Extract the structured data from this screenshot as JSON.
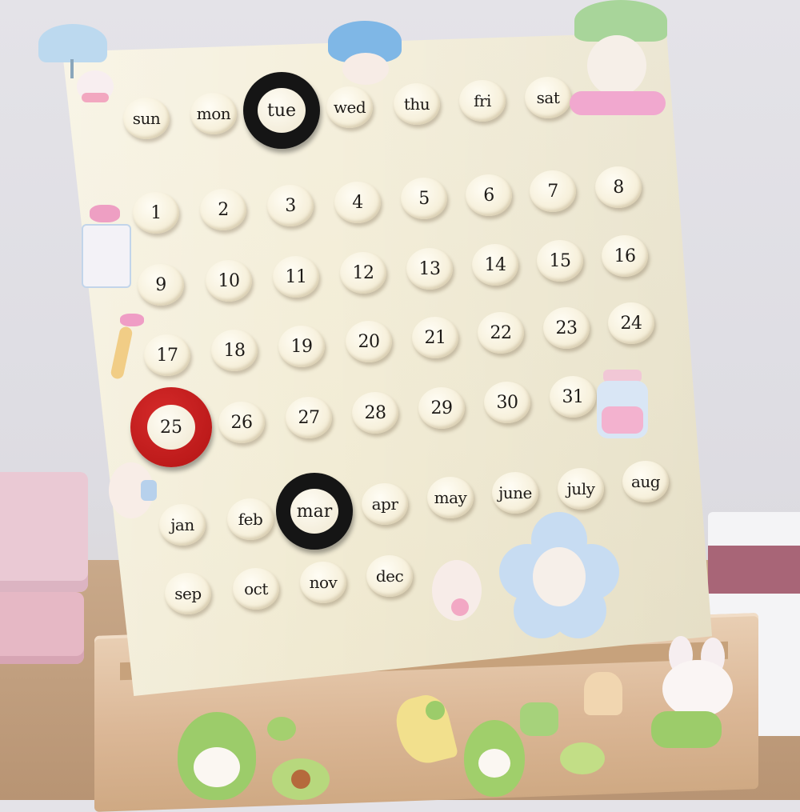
{
  "weekdays": [
    "sun",
    "mon",
    "tue",
    "wed",
    "thu",
    "fri",
    "sat"
  ],
  "days": [
    "1",
    "2",
    "3",
    "4",
    "5",
    "6",
    "7",
    "8",
    "9",
    "10",
    "11",
    "12",
    "13",
    "14",
    "15",
    "16",
    "17",
    "18",
    "19",
    "20",
    "21",
    "22",
    "23",
    "24",
    "25",
    "26",
    "27",
    "28",
    "29",
    "30",
    "31"
  ],
  "months": [
    "jan",
    "feb",
    "mar",
    "apr",
    "may",
    "june",
    "july",
    "aug",
    "sep",
    "oct",
    "nov",
    "dec"
  ],
  "selected": {
    "weekday": "tue",
    "day": "25",
    "month": "mar"
  },
  "colors": {
    "board": "#f4eed8",
    "peg": "#f7f1dd",
    "weekday_marker": "#151515",
    "day_marker": "#c61e1e",
    "month_marker": "#151515",
    "base_wood": "#dbb796"
  },
  "stickers": [
    "umbrella-sticker",
    "bunny-sticker",
    "mushroom-sticker",
    "leaf-umbrella-sticker",
    "bow-sticker",
    "jar-sticker",
    "flower-sticker",
    "avocado-sticker",
    "bunny-avocado-sticker"
  ]
}
